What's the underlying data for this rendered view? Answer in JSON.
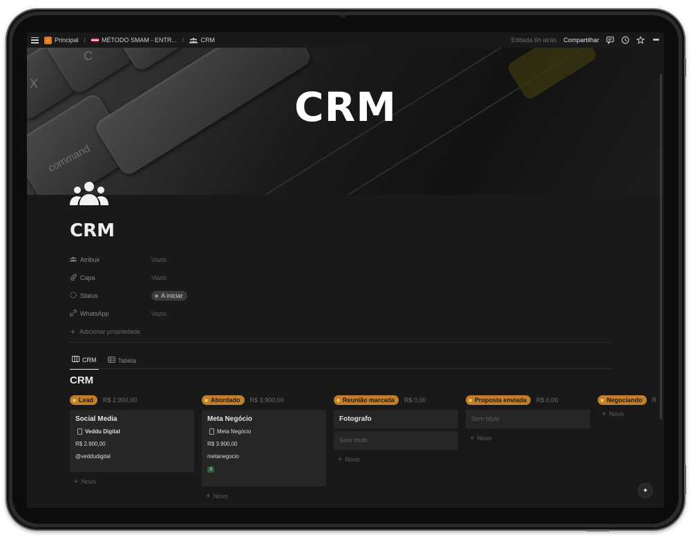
{
  "topbar": {
    "breadcrumbs": [
      {
        "label": "Principal",
        "icon": "house-icon"
      },
      {
        "label": "MÉTODO SMAM - ENTR...",
        "icon": "flag-icon"
      },
      {
        "label": "CRM",
        "icon": "people-icon"
      }
    ],
    "edited": "Editada 6h atrás",
    "share_label": "Compartilhar"
  },
  "cover": {
    "title": "CRM",
    "key_label": "command"
  },
  "page": {
    "title": "CRM"
  },
  "properties": [
    {
      "name": "Atribuir",
      "icon": "people-icon",
      "value": "Vazio"
    },
    {
      "name": "Capa",
      "icon": "paperclip-icon",
      "value": "Vazio"
    },
    {
      "name": "Status",
      "icon": "status-icon",
      "value": "A iniciar"
    },
    {
      "name": "WhatsApp",
      "icon": "link-icon",
      "value": "Vazio"
    }
  ],
  "add_property_label": "Adicionar propriedade",
  "tabs": [
    {
      "label": "CRM",
      "icon": "board-icon",
      "active": true
    },
    {
      "label": "Tabela",
      "icon": "table-icon",
      "active": false
    }
  ],
  "database": {
    "title": "CRM"
  },
  "columns": [
    {
      "name": "Lead",
      "sum": "R$ 2.900,00",
      "color": "#c07f2c",
      "cards": [
        {
          "title": "Social Media",
          "company": "Veddu Digital",
          "value": "R$ 2.900,00",
          "handle": "@veddudigital"
        }
      ],
      "new_label": "Novo"
    },
    {
      "name": "Abordado",
      "sum": "R$ 3.900,00",
      "color": "#c07f2c",
      "cards": [
        {
          "title": "Meta Negócio",
          "company": "Meta Negócio",
          "value": "R$ 3.900,00",
          "handle": "metanegocio",
          "badge": "3"
        }
      ],
      "new_label": "Novo"
    },
    {
      "name": "Reunião marcada",
      "sum": "R$ 0,00",
      "color": "#c07f2c",
      "cards": [
        {
          "title": "Fotografo"
        },
        {
          "title": "Sem título"
        }
      ],
      "new_label": "Novo"
    },
    {
      "name": "Proposta enviada",
      "sum": "R$ 0,00",
      "color": "#c07f2c",
      "cards": [
        {
          "title": "Sem título"
        }
      ],
      "new_label": "Novo"
    },
    {
      "name": "Negociando",
      "sum": "R",
      "color": "#c07f2c",
      "cards": [],
      "new_label": "Novo"
    }
  ]
}
